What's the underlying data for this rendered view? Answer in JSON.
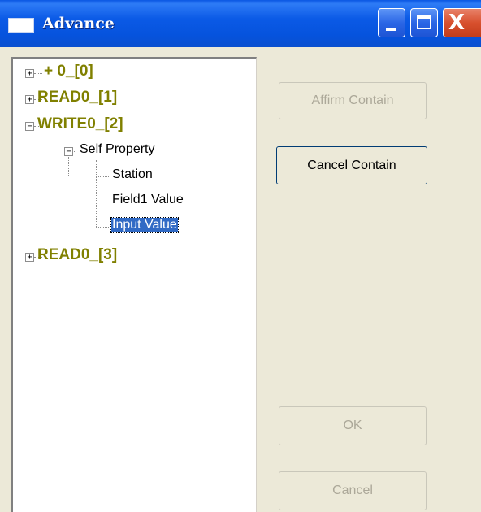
{
  "window": {
    "title": "Advance",
    "controls": {
      "minimize": "_",
      "maximize": "□",
      "close": "X"
    }
  },
  "tree": {
    "nodes": [
      {
        "label": "+ 0_[0]",
        "expander": "+"
      },
      {
        "label": "READ0_[1]",
        "expander": "+"
      },
      {
        "label": "WRITE0_[2]",
        "expander": "−",
        "children": [
          {
            "label": "Self Property",
            "expander": "−",
            "children": [
              {
                "label": "Station"
              },
              {
                "label": "Field1 Value"
              },
              {
                "label": "Input Value",
                "selected": true
              }
            ]
          }
        ]
      },
      {
        "label": "READ0_[3]",
        "expander": "+"
      }
    ]
  },
  "buttons": {
    "affirm_contain": {
      "label": "Affirm Contain",
      "enabled": false
    },
    "cancel_contain": {
      "label": "Cancel Contain",
      "enabled": true
    },
    "ok": {
      "label": "OK",
      "enabled": false
    },
    "cancel": {
      "label": "Cancel",
      "enabled": false
    }
  },
  "colors": {
    "window_bg": "#ECE9D8",
    "title_bar": "#0B5AE6",
    "root_node_text": "#808000",
    "selection_bg": "#316AC5",
    "disabled_text": "#ACA899"
  }
}
